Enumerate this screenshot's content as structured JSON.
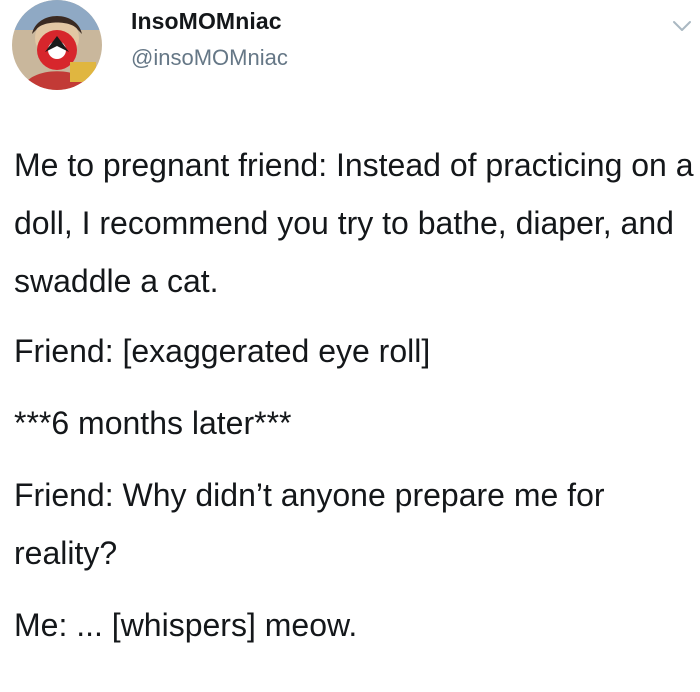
{
  "tweet": {
    "author": {
      "display_name": "InsoMOMniac",
      "handle": "@insoMOMniac"
    },
    "icons": {
      "avatar": "profile-photo",
      "menu": "chevron-down-icon"
    },
    "colors": {
      "text": "#14171a",
      "secondary": "#657786",
      "chevron": "#aab8c2"
    },
    "body": [
      "Me to pregnant friend: Instead of practicing on a doll, I recommend you try to bathe, diaper, and swaddle a cat.",
      "Friend: [exaggerated eye roll]",
      "***6 months later***",
      "Friend: Why didn’t anyone prepare me for reality?",
      "Me: ... [whispers] meow."
    ]
  }
}
